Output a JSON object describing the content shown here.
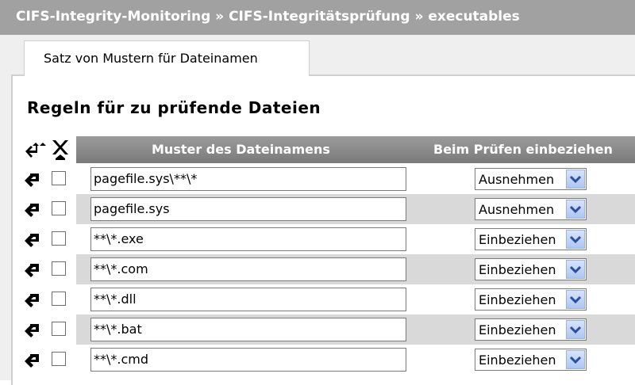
{
  "breadcrumb": "CIFS-Integrity-Monitoring » CIFS-Integritätsprüfung » executables",
  "tab": {
    "label": "Satz von Mustern für Dateinamen"
  },
  "section_heading": "Regeln für zu prüfende Dateien",
  "table": {
    "columns": [
      "Muster des Dateinamens",
      "Beim Prüfen einbeziehen"
    ],
    "rows": [
      {
        "pattern": "pagefile.sys\\**\\*",
        "mode": "Ausnehmen"
      },
      {
        "pattern": "pagefile.sys",
        "mode": "Ausnehmen"
      },
      {
        "pattern": "**\\*.exe",
        "mode": "Einbeziehen"
      },
      {
        "pattern": "**\\*.com",
        "mode": "Einbeziehen"
      },
      {
        "pattern": "**\\*.dll",
        "mode": "Einbeziehen"
      },
      {
        "pattern": "**\\*.bat",
        "mode": "Einbeziehen"
      },
      {
        "pattern": "**\\*.cmd",
        "mode": "Einbeziehen"
      }
    ]
  },
  "icons": {
    "move_all": "move-arrows-icon",
    "delete_all": "delete-x-icon",
    "row_move": "move-row-icon",
    "dropdown": "chevron-down-icon"
  },
  "colors": {
    "titlebar": "#a1a1a1",
    "header_bar": "#8a8a8a",
    "alt_row": "#d9d9d9",
    "select_button": "#b8cdf5"
  }
}
